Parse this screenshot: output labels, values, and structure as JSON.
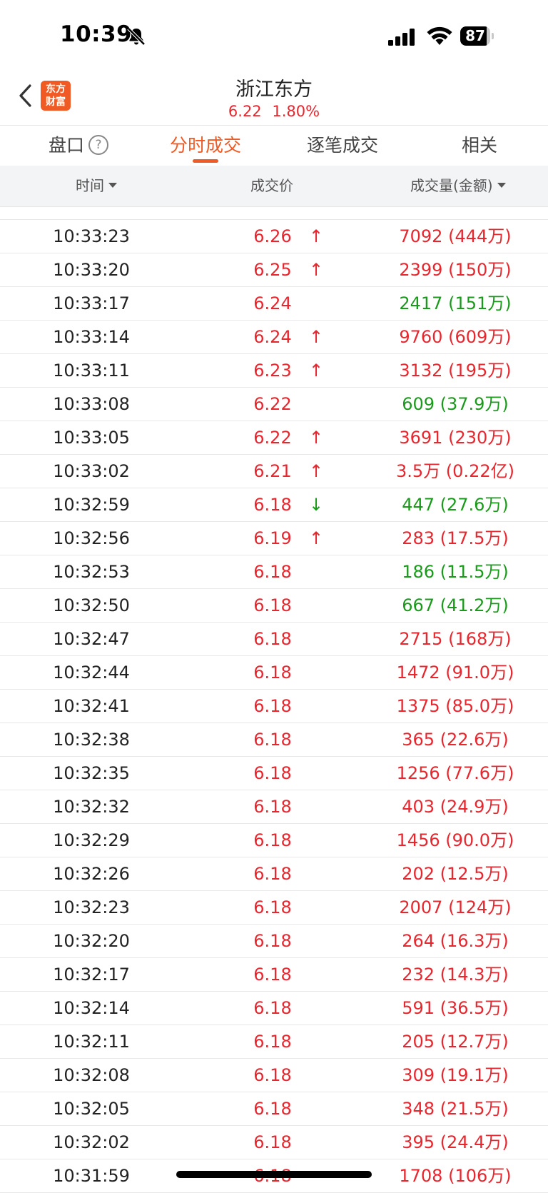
{
  "status_bar": {
    "time": "10:39",
    "battery": "87",
    "battery_level": 0.87
  },
  "header": {
    "stock_name": "浙江东方",
    "price": "6.22",
    "change_pct": "1.80%",
    "logo_line1": "东方",
    "logo_line2": "财富"
  },
  "tabs": [
    {
      "label": "盘口",
      "help": "?"
    },
    {
      "label": "分时成交"
    },
    {
      "label": "逐笔成交"
    },
    {
      "label": "相关"
    }
  ],
  "columns": {
    "time": "时间",
    "price": "成交价",
    "volume": "成交量(金额)"
  },
  "colors": {
    "up": "#e8262e",
    "down": "#1a9a1a",
    "accent": "#f05a24"
  },
  "trades": [
    {
      "time": "10:33:23",
      "price": "6.26",
      "arrow": "↑",
      "volume": "7092 (444万)",
      "vol_color": "red"
    },
    {
      "time": "10:33:20",
      "price": "6.25",
      "arrow": "↑",
      "volume": "2399 (150万)",
      "vol_color": "red"
    },
    {
      "time": "10:33:17",
      "price": "6.24",
      "arrow": "",
      "volume": "2417 (151万)",
      "vol_color": "green"
    },
    {
      "time": "10:33:14",
      "price": "6.24",
      "arrow": "↑",
      "volume": "9760 (609万)",
      "vol_color": "red"
    },
    {
      "time": "10:33:11",
      "price": "6.23",
      "arrow": "↑",
      "volume": "3132 (195万)",
      "vol_color": "red"
    },
    {
      "time": "10:33:08",
      "price": "6.22",
      "arrow": "",
      "volume": "609 (37.9万)",
      "vol_color": "green"
    },
    {
      "time": "10:33:05",
      "price": "6.22",
      "arrow": "↑",
      "volume": "3691 (230万)",
      "vol_color": "red"
    },
    {
      "time": "10:33:02",
      "price": "6.21",
      "arrow": "↑",
      "volume": "3.5万 (0.22亿)",
      "vol_color": "red"
    },
    {
      "time": "10:32:59",
      "price": "6.18",
      "arrow": "↓",
      "volume": "447 (27.6万)",
      "vol_color": "green"
    },
    {
      "time": "10:32:56",
      "price": "6.19",
      "arrow": "↑",
      "volume": "283 (17.5万)",
      "vol_color": "red"
    },
    {
      "time": "10:32:53",
      "price": "6.18",
      "arrow": "",
      "volume": "186 (11.5万)",
      "vol_color": "green"
    },
    {
      "time": "10:32:50",
      "price": "6.18",
      "arrow": "",
      "volume": "667 (41.2万)",
      "vol_color": "green"
    },
    {
      "time": "10:32:47",
      "price": "6.18",
      "arrow": "",
      "volume": "2715 (168万)",
      "vol_color": "red"
    },
    {
      "time": "10:32:44",
      "price": "6.18",
      "arrow": "",
      "volume": "1472 (91.0万)",
      "vol_color": "red"
    },
    {
      "time": "10:32:41",
      "price": "6.18",
      "arrow": "",
      "volume": "1375 (85.0万)",
      "vol_color": "red"
    },
    {
      "time": "10:32:38",
      "price": "6.18",
      "arrow": "",
      "volume": "365 (22.6万)",
      "vol_color": "red"
    },
    {
      "time": "10:32:35",
      "price": "6.18",
      "arrow": "",
      "volume": "1256 (77.6万)",
      "vol_color": "red"
    },
    {
      "time": "10:32:32",
      "price": "6.18",
      "arrow": "",
      "volume": "403 (24.9万)",
      "vol_color": "red"
    },
    {
      "time": "10:32:29",
      "price": "6.18",
      "arrow": "",
      "volume": "1456 (90.0万)",
      "vol_color": "red"
    },
    {
      "time": "10:32:26",
      "price": "6.18",
      "arrow": "",
      "volume": "202 (12.5万)",
      "vol_color": "red"
    },
    {
      "time": "10:32:23",
      "price": "6.18",
      "arrow": "",
      "volume": "2007 (124万)",
      "vol_color": "red"
    },
    {
      "time": "10:32:20",
      "price": "6.18",
      "arrow": "",
      "volume": "264 (16.3万)",
      "vol_color": "red"
    },
    {
      "time": "10:32:17",
      "price": "6.18",
      "arrow": "",
      "volume": "232 (14.3万)",
      "vol_color": "red"
    },
    {
      "time": "10:32:14",
      "price": "6.18",
      "arrow": "",
      "volume": "591 (36.5万)",
      "vol_color": "red"
    },
    {
      "time": "10:32:11",
      "price": "6.18",
      "arrow": "",
      "volume": "205 (12.7万)",
      "vol_color": "red"
    },
    {
      "time": "10:32:08",
      "price": "6.18",
      "arrow": "",
      "volume": "309 (19.1万)",
      "vol_color": "red"
    },
    {
      "time": "10:32:05",
      "price": "6.18",
      "arrow": "",
      "volume": "348 (21.5万)",
      "vol_color": "red"
    },
    {
      "time": "10:32:02",
      "price": "6.18",
      "arrow": "",
      "volume": "395 (24.4万)",
      "vol_color": "red"
    },
    {
      "time": "10:31:59",
      "price": "6.18",
      "arrow": "",
      "volume": "1708 (106万)",
      "vol_color": "red"
    }
  ]
}
